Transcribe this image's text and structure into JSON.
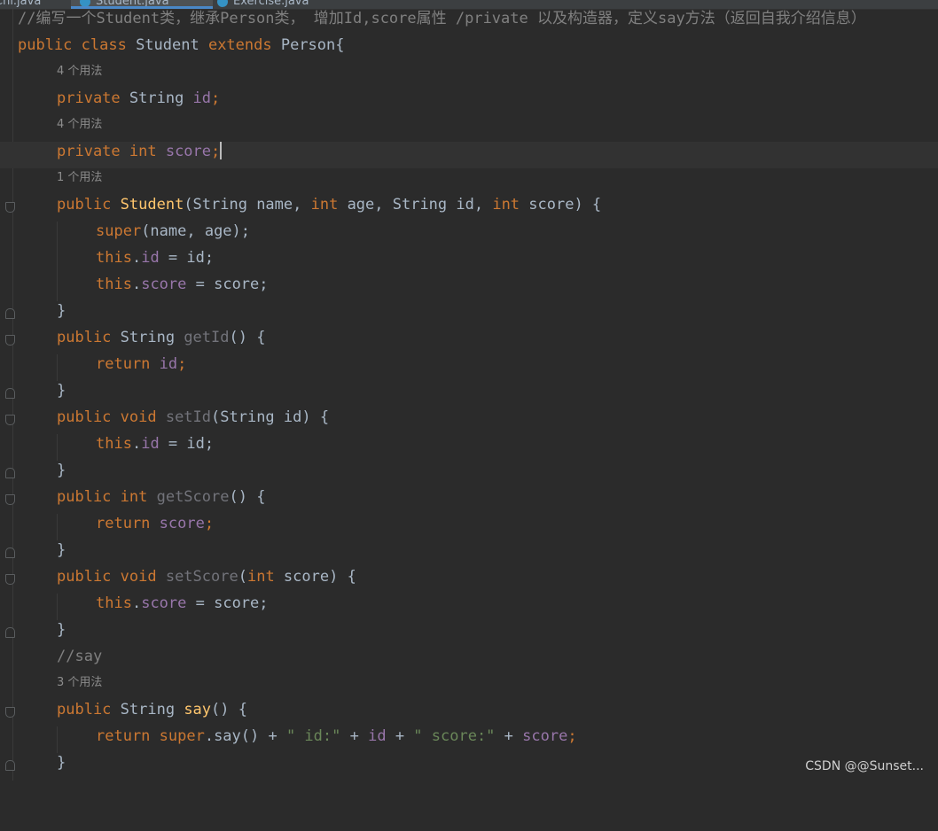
{
  "tabs": [
    {
      "label": "Chi.java",
      "active": false
    },
    {
      "label": "Student.java",
      "active": true
    },
    {
      "label": "Exercise.java",
      "active": false
    }
  ],
  "lines": {
    "comment_top": "//编写一个Student类，继承Person类， 增加Id,score属性 /private 以及构造器，定义say方法（返回自我介绍信息）",
    "class_decl": {
      "kw": "public class ",
      "name": "Student ",
      "kw2": "extends ",
      "parent": "Person{"
    },
    "hint1": "4 个用法",
    "field_id": {
      "kw": "private ",
      "type": "String ",
      "name": "id",
      "end": ";"
    },
    "hint2": "4 个用法",
    "field_score": {
      "kw": "private int ",
      "name": "score",
      "end": ";"
    },
    "hint3": "1 个用法",
    "ctor": {
      "kw": "public ",
      "name": "Student",
      "params": "(String name, ",
      "kw_int1": "int",
      "p2": " age, String id, ",
      "kw_int2": "int",
      "p3": " score) {"
    },
    "super_call": {
      "kw": "super",
      "rest": "(name, age);"
    },
    "this_id": {
      "kw": "this",
      "dot": ".",
      "field": "id",
      "rest": " = id;"
    },
    "this_score": {
      "kw": "this",
      "dot": ".",
      "field": "score",
      "rest": " = score;"
    },
    "brace": "}",
    "getid": {
      "kw": "public ",
      "type": "String ",
      "name": "getId",
      "rest": "() {"
    },
    "return_id": {
      "kw": "return ",
      "field": "id",
      "end": ";"
    },
    "setid": {
      "kw": "public void ",
      "name": "setId",
      "rest": "(String id) {"
    },
    "getscore": {
      "kw": "public int ",
      "name": "getScore",
      "rest": "() {"
    },
    "return_score": {
      "kw": "return ",
      "field": "score",
      "end": ";"
    },
    "setscore": {
      "kw": "public void ",
      "name": "setScore",
      "p": "(",
      "kw_int": "int",
      "rest": " score) {"
    },
    "comment_say": "//say",
    "hint4": "3 个用法",
    "say_decl": {
      "kw": "public ",
      "type": "String ",
      "name": "say",
      "rest": "() {"
    },
    "say_return": {
      "kw": "return super",
      "dot": ".say() + ",
      "s1": "\" id:\"",
      "plus1": " + ",
      "f1": "id",
      "plus2": " + ",
      "s2": "\" score:\"",
      "plus3": " + ",
      "f2": "score",
      "end": ";"
    }
  },
  "watermark": "CSDN @@Sunset..."
}
